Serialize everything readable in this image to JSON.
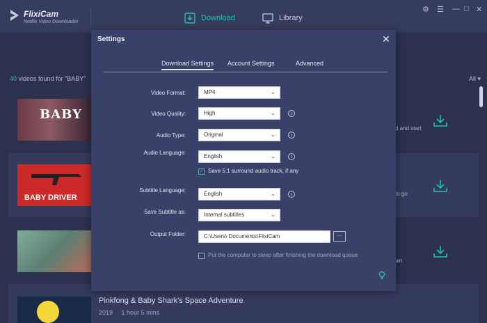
{
  "app": {
    "name": "FlixiCam",
    "subtitle": "Netflix Video Downloader"
  },
  "nav": {
    "download": "Download",
    "library": "Library"
  },
  "window_controls": {
    "settings": "⚙",
    "menu": "☰",
    "minimize": "—",
    "maximize": "□",
    "close": "✕"
  },
  "results": {
    "count": "40",
    "text": "videos found for \"BABY\"",
    "filter": "All ▾"
  },
  "rows": [
    {
      "thumb_text": "BABY",
      "peek": "d and start"
    },
    {
      "thumb_text": "BABY DRIVER",
      "peek": "to go"
    },
    {
      "thumb_text": "",
      "peek": "wn"
    },
    {
      "title": "Pinkfong & Baby Shark's Space Adventure",
      "year": "2019",
      "duration": "1 hour 5 mins"
    }
  ],
  "settings": {
    "title": "Settings",
    "close": "✕",
    "tabs": [
      "Download Settings",
      "Account Settings",
      "Advanced"
    ],
    "video_format": {
      "label": "Video Format:",
      "value": "MP4"
    },
    "video_quality": {
      "label": "Video Quality:",
      "value": "High"
    },
    "audio_type": {
      "label": "Audio Type:",
      "value": "Original"
    },
    "audio_language": {
      "label": "Audio Language:",
      "value": "English"
    },
    "surround": {
      "label": "Save 5.1 surround audio track, if any",
      "checked": true
    },
    "subtitle_language": {
      "label": "Subtitle Language:",
      "value": "English"
    },
    "save_subtitle": {
      "label": "Save Subtitle as:",
      "value": "Internal subtitles"
    },
    "output_folder": {
      "label": "Output Folder:",
      "value": "C:\\Users\\        Documents\\FlixiCam",
      "browse": "···"
    },
    "sleep": {
      "label": "Put the computer to sleep after finishing the download queue",
      "checked": false
    }
  },
  "colors": {
    "accent": "#20c3b3",
    "modal": "#3a4168",
    "background": "#2c3150"
  }
}
